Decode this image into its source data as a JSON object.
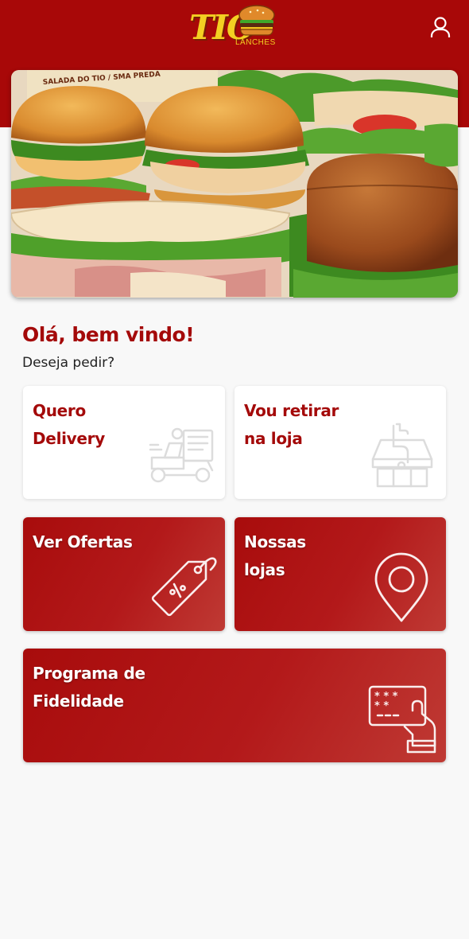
{
  "header": {
    "logo_text": "TIO",
    "logo_subtitle": "LANCHES",
    "user_icon": "user-icon"
  },
  "hero": {
    "image": "burgers-photo",
    "wrapper_text": "SALADA DO TIO / SMA PREDA"
  },
  "greeting": {
    "title": "Olá, bem vindo!",
    "subtitle": "Deseja pedir?"
  },
  "cards": {
    "delivery": {
      "line1": "Quero",
      "line2": "Delivery",
      "icon": "delivery-scooter-icon"
    },
    "pickup": {
      "line1": "Vou retirar",
      "line2": "na loja",
      "icon": "store-pickup-icon"
    },
    "offers": {
      "line1": "Ver Ofertas",
      "icon": "price-tag-icon"
    },
    "stores": {
      "line1": "Nossas",
      "line2": "lojas",
      "icon": "location-pin-icon"
    },
    "loyalty": {
      "line1": "Programa de",
      "line2": "Fidelidade",
      "icon": "loyalty-card-icon"
    }
  },
  "colors": {
    "brand_red": "#a80808",
    "logo_yellow": "#f3cf22",
    "background": "#f8f8f8"
  }
}
